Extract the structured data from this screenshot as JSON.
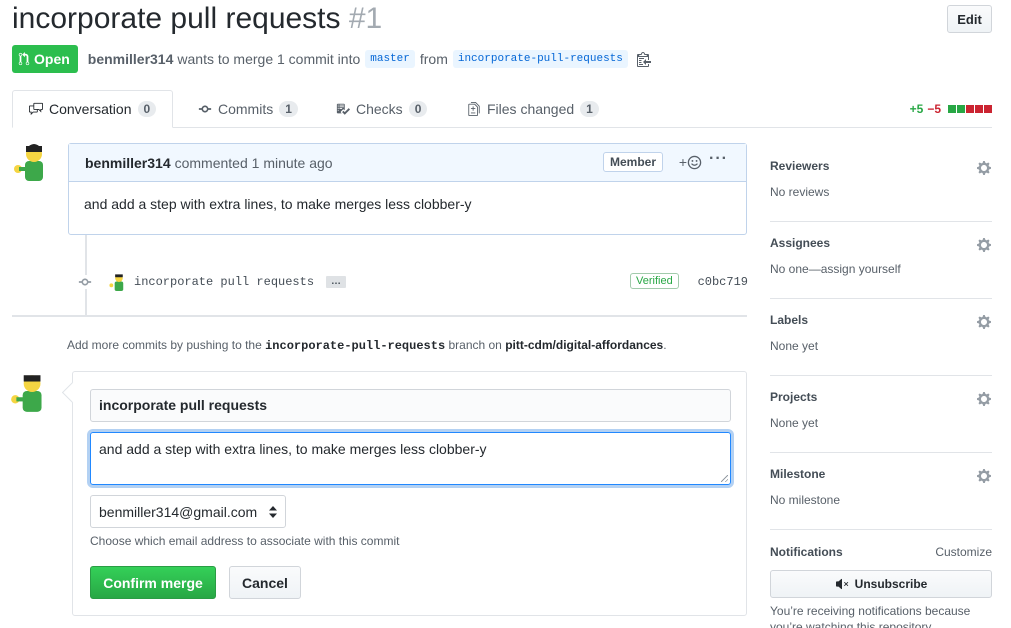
{
  "header": {
    "title": "incorporate pull requests",
    "number": "#1",
    "edit_label": "Edit"
  },
  "meta": {
    "state": "Open",
    "author": "benmiller314",
    "text_wants": "wants to merge 1 commit into",
    "base_branch": "master",
    "text_from": "from",
    "head_branch": "incorporate-pull-requests"
  },
  "tabs": [
    {
      "label": "Conversation",
      "count": "0",
      "icon": "comment-discussion-icon"
    },
    {
      "label": "Commits",
      "count": "1",
      "icon": "git-commit-icon"
    },
    {
      "label": "Checks",
      "count": "0",
      "icon": "checklist-icon"
    },
    {
      "label": "Files changed",
      "count": "1",
      "icon": "file-diff-icon"
    }
  ],
  "diffstat": {
    "additions": "+5",
    "deletions": "−5",
    "colors": [
      "#28a745",
      "#28a745",
      "#cb2431",
      "#cb2431",
      "#cb2431"
    ]
  },
  "comment": {
    "author": "benmiller314",
    "action": "commented 1 minute ago",
    "role": "Member",
    "body": "and add a step with extra lines, to make merges less clobber-y"
  },
  "commit": {
    "message": "incorporate pull requests",
    "ellipsis": "…",
    "badge": "Verified",
    "sha": "c0bc719"
  },
  "push_hint": {
    "prefix": "Add more commits by pushing to the",
    "branch": "incorporate-pull-requests",
    "middle": "branch on",
    "repo": "pitt-cdm/digital-affordances",
    "suffix": "."
  },
  "merge": {
    "commit_title": "incorporate pull requests",
    "commit_body": "and add a step with extra lines, to make merges less clobber-y",
    "email": "benmiller314@gmail.com",
    "email_hint": "Choose which email address to associate with this commit",
    "confirm_label": "Confirm merge",
    "cancel_label": "Cancel"
  },
  "sidebar": {
    "sections": [
      {
        "title": "Reviewers",
        "value": "No reviews"
      },
      {
        "title": "Assignees",
        "value": "No one—assign yourself"
      },
      {
        "title": "Labels",
        "value": "None yet"
      },
      {
        "title": "Projects",
        "value": "None yet"
      },
      {
        "title": "Milestone",
        "value": "No milestone"
      }
    ],
    "notifications": {
      "title": "Notifications",
      "customize": "Customize",
      "button": "Unsubscribe",
      "text": "You’re receiving notifications because you’re watching this repository."
    }
  },
  "colors": {
    "open_green": "#2cbe4e",
    "link_blue": "#0366d6",
    "merge_green": "#28a745"
  }
}
